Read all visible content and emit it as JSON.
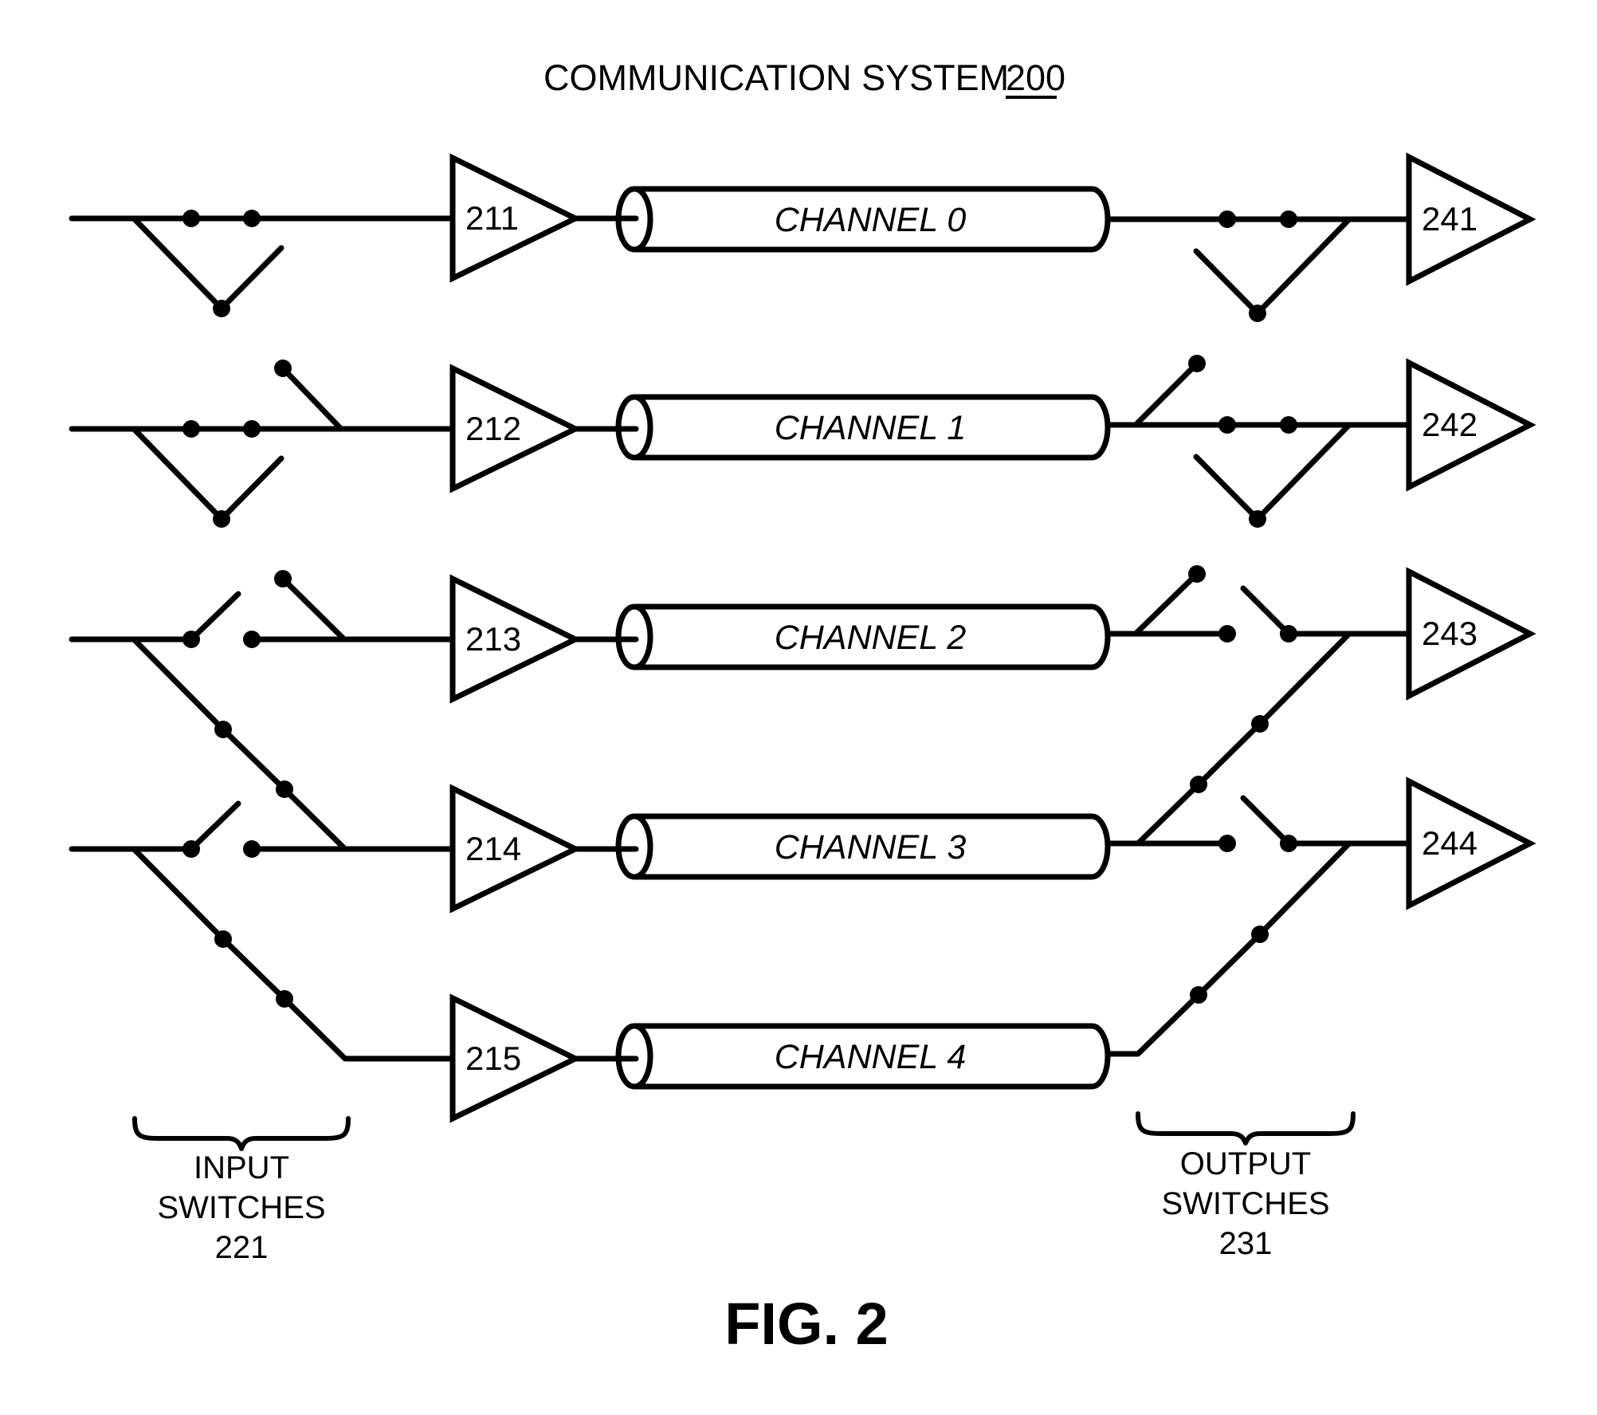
{
  "title": {
    "text": "COMMUNICATION SYSTEM",
    "ref": "200"
  },
  "figure_label": "FIG. 2",
  "input_amplifiers": [
    "211",
    "212",
    "213",
    "214",
    "215"
  ],
  "channels": [
    "CHANNEL 0",
    "CHANNEL 1",
    "CHANNEL 2",
    "CHANNEL 3",
    "CHANNEL 4"
  ],
  "output_amplifiers": [
    "241",
    "242",
    "243",
    "244"
  ],
  "input_switches": {
    "lines": [
      "INPUT",
      "SWITCHES",
      "221"
    ]
  },
  "output_switches": {
    "lines": [
      "OUTPUT",
      "SWITCHES",
      "231"
    ]
  }
}
